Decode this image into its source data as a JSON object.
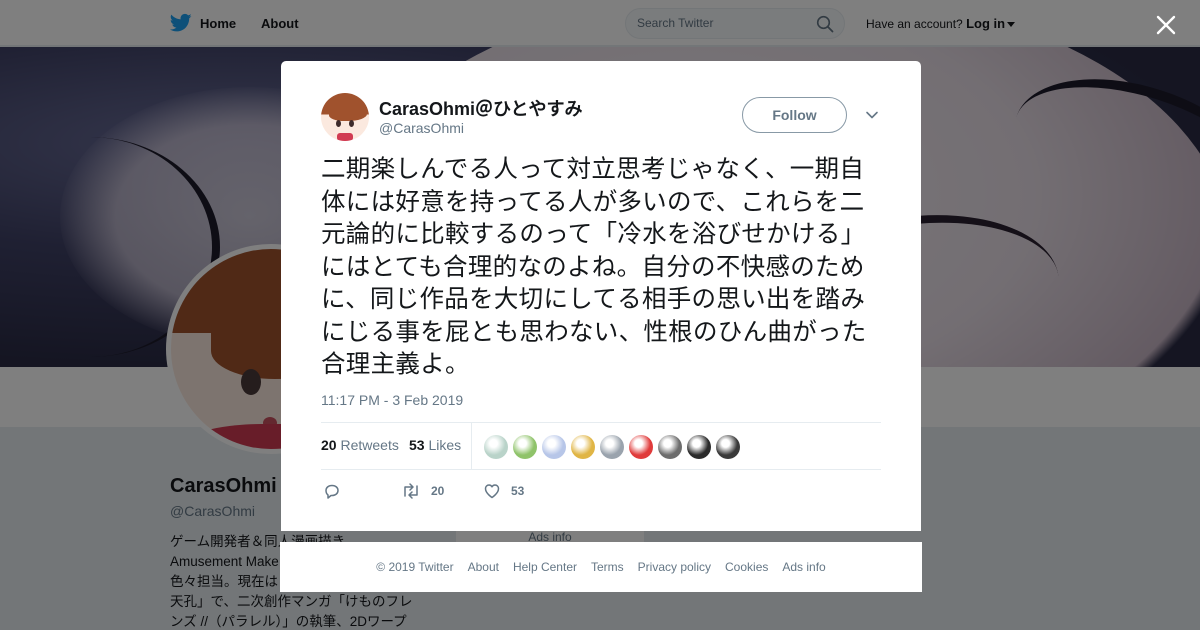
{
  "nav": {
    "home_label": "Home",
    "about_label": "About",
    "search_placeholder": "Search Twitter",
    "account_prompt": "Have an account?",
    "login_label": "Log in",
    "brand_color": "#1da1f2"
  },
  "profile": {
    "name": "CarasOhmi",
    "handle": "@CarasOhmi",
    "bio_lines": [
      "ゲーム開発者＆同人漫画描き",
      "Amusement Make",
      "色々担当。現在は",
      "天孔」で、二次創作マンガ「けものフレ",
      "ンズ //（パラレル）」の執筆、2Dワープ"
    ],
    "ads_label": "Ads info"
  },
  "tweet": {
    "display_name": "CarasOhmi＠ひとやすみ",
    "handle": "@CarasOhmi",
    "follow_label": "Follow",
    "text": "二期楽しんでる人って対立思考じゃなく、一期自体には好意を持ってる人が多いので、これらを二元論的に比較するのって「冷水を浴びせかける」にはとても合理的なのよね。自分の不快感のために、同じ作品を大切にしてる相手の思い出を踏みにじる事を屁とも思わない、性根のひん曲がった合理主義よ。",
    "timestamp": "11:17 PM - 3 Feb 2019",
    "retweets_count": "20",
    "retweets_label": "Retweets",
    "likes_count": "53",
    "likes_label": "Likes",
    "action_retweets": "20",
    "action_likes": "53",
    "likers": [
      {
        "color": "#b9d3c9"
      },
      {
        "color": "#8fc36a"
      },
      {
        "color": "#b7c6e8"
      },
      {
        "color": "#e0b545"
      },
      {
        "color": "#9aa3ad"
      },
      {
        "color": "#e03b3b"
      },
      {
        "color": "#6d6d6d"
      },
      {
        "color": "#2b2b2b"
      },
      {
        "color": "#3a3a3a"
      }
    ]
  },
  "footer": {
    "links": [
      "© 2019 Twitter",
      "About",
      "Help Center",
      "Terms",
      "Privacy policy",
      "Cookies",
      "Ads info"
    ]
  }
}
